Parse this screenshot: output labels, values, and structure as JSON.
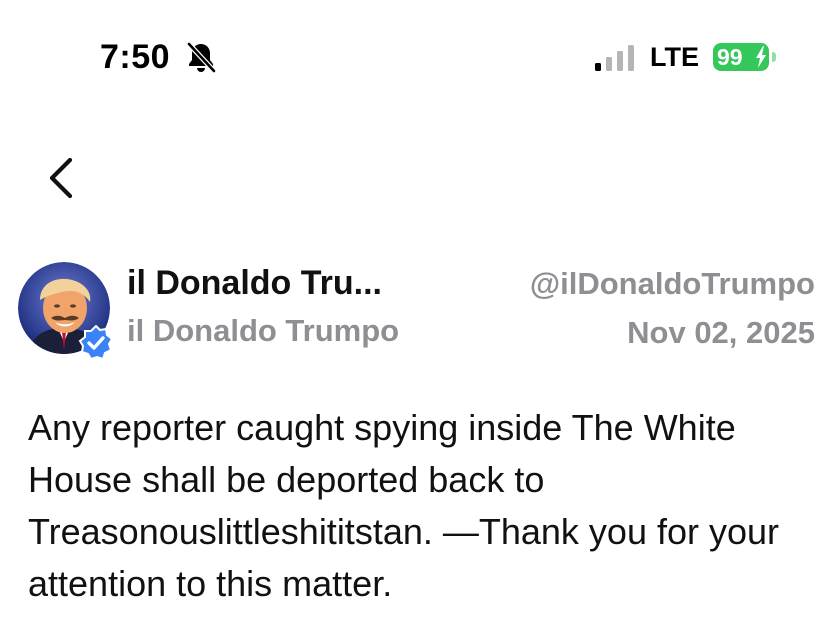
{
  "status_bar": {
    "time": "7:50",
    "network": "LTE",
    "battery": "99",
    "battery_color": "#34c759",
    "icons": [
      "bell-slash-icon",
      "signal-icon",
      "charging-bolt-icon"
    ]
  },
  "nav": {
    "back_icon": "chevron-left-icon"
  },
  "post": {
    "display_name": "il Donaldo Tru...",
    "sub_name": "il Donaldo Trumpo",
    "handle": "@ilDonaldoTrumpo",
    "date": "Nov 02, 2025",
    "verified_color": "#3b82f6",
    "body": "Any reporter caught spying inside The White House shall be deported back to Treasonouslittleshititstan. —Thank you for your attention to this matter."
  }
}
